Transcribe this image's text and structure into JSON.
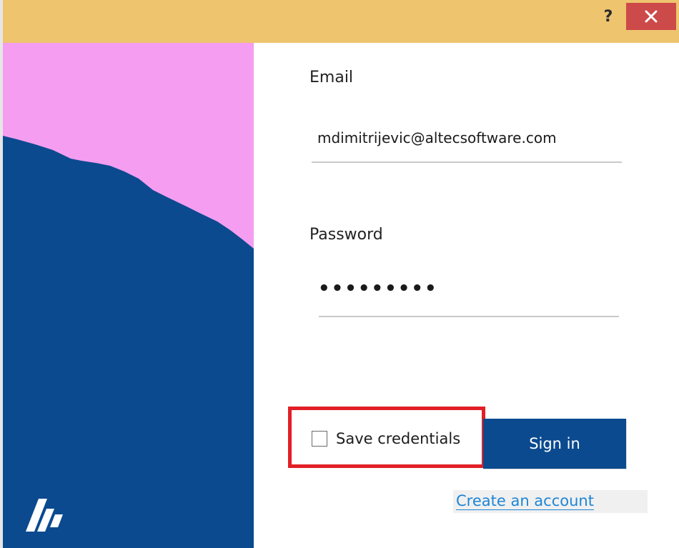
{
  "window": {
    "help_label": "?",
    "title_bar_color": "#eec46e",
    "close_color": "#cd4a4a"
  },
  "side_panel": {
    "sky_color": "#f59df0",
    "hill_color": "#0b4a8f",
    "logo_icon": "altec-logo-icon"
  },
  "form": {
    "email_label": "Email",
    "email_value": "mdimitrijevic@altecsoftware.com",
    "password_label": "Password",
    "password_value": "•••••••••",
    "save_credentials_label": "Save credentials",
    "save_credentials_checked": false,
    "sign_in_label": "Sign in",
    "create_account_label": "Create an account",
    "accent_color": "#0b4a8f",
    "link_color": "#1e86d6",
    "highlight_color": "#e21f26"
  }
}
